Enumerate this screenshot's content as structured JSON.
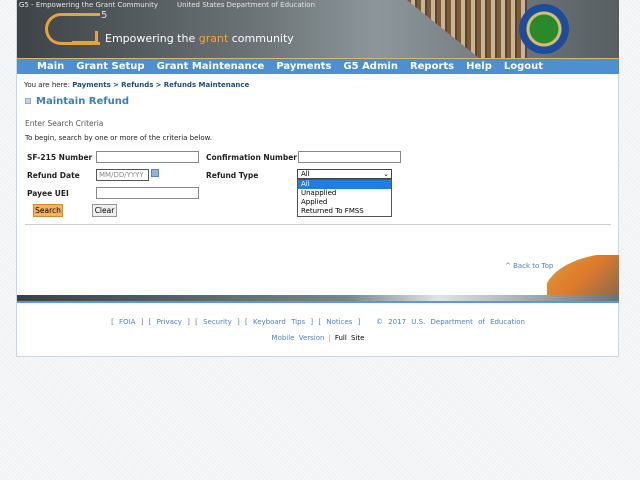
{
  "header": {
    "logo_alt": "G5 - Empowering the Grant Community",
    "seal_alt": "United States Department of Education",
    "logo_sup": "5",
    "tagline_pre": "Empowering the ",
    "tagline_accent": "grant",
    "tagline_post": " community"
  },
  "nav": [
    "Main",
    "Grant Setup",
    "Grant Maintenance",
    "Payments",
    "G5 Admin",
    "Reports",
    "Help",
    "Logout"
  ],
  "breadcrumb": {
    "prefix": "You are here:",
    "items": [
      "Payments",
      "Refunds",
      "Refunds Maintenance"
    ],
    "sep": ">"
  },
  "page_title": "Maintain Refund",
  "section_title": "Enter Search Criteria",
  "intro": "To begin, search by one or more of the criteria below.",
  "form": {
    "sf215_label": "SF-215 Number",
    "sf215_value": "",
    "confirmation_label": "Confirmation Number",
    "confirmation_value": "",
    "refund_date_label": "Refund Date",
    "refund_date_placeholder": "MM/DD/YYYY",
    "refund_type_label": "Refund Type",
    "refund_type_selected": "All",
    "refund_type_options": [
      "All",
      "Unapplied",
      "Applied",
      "Returned To FMSS"
    ],
    "payee_uei_label": "Payee UEI",
    "payee_uei_value": "",
    "search_label": "Search",
    "clear_label": "Clear"
  },
  "back_to_top": "^ Back to Top",
  "footer": {
    "links": [
      "FOIA",
      "Privacy",
      "Security",
      "Keyboard Tips",
      "Notices"
    ],
    "copyright": "© 2017 U.S. Department of Education",
    "mobile": "Mobile Version",
    "full": "Full Site"
  }
}
